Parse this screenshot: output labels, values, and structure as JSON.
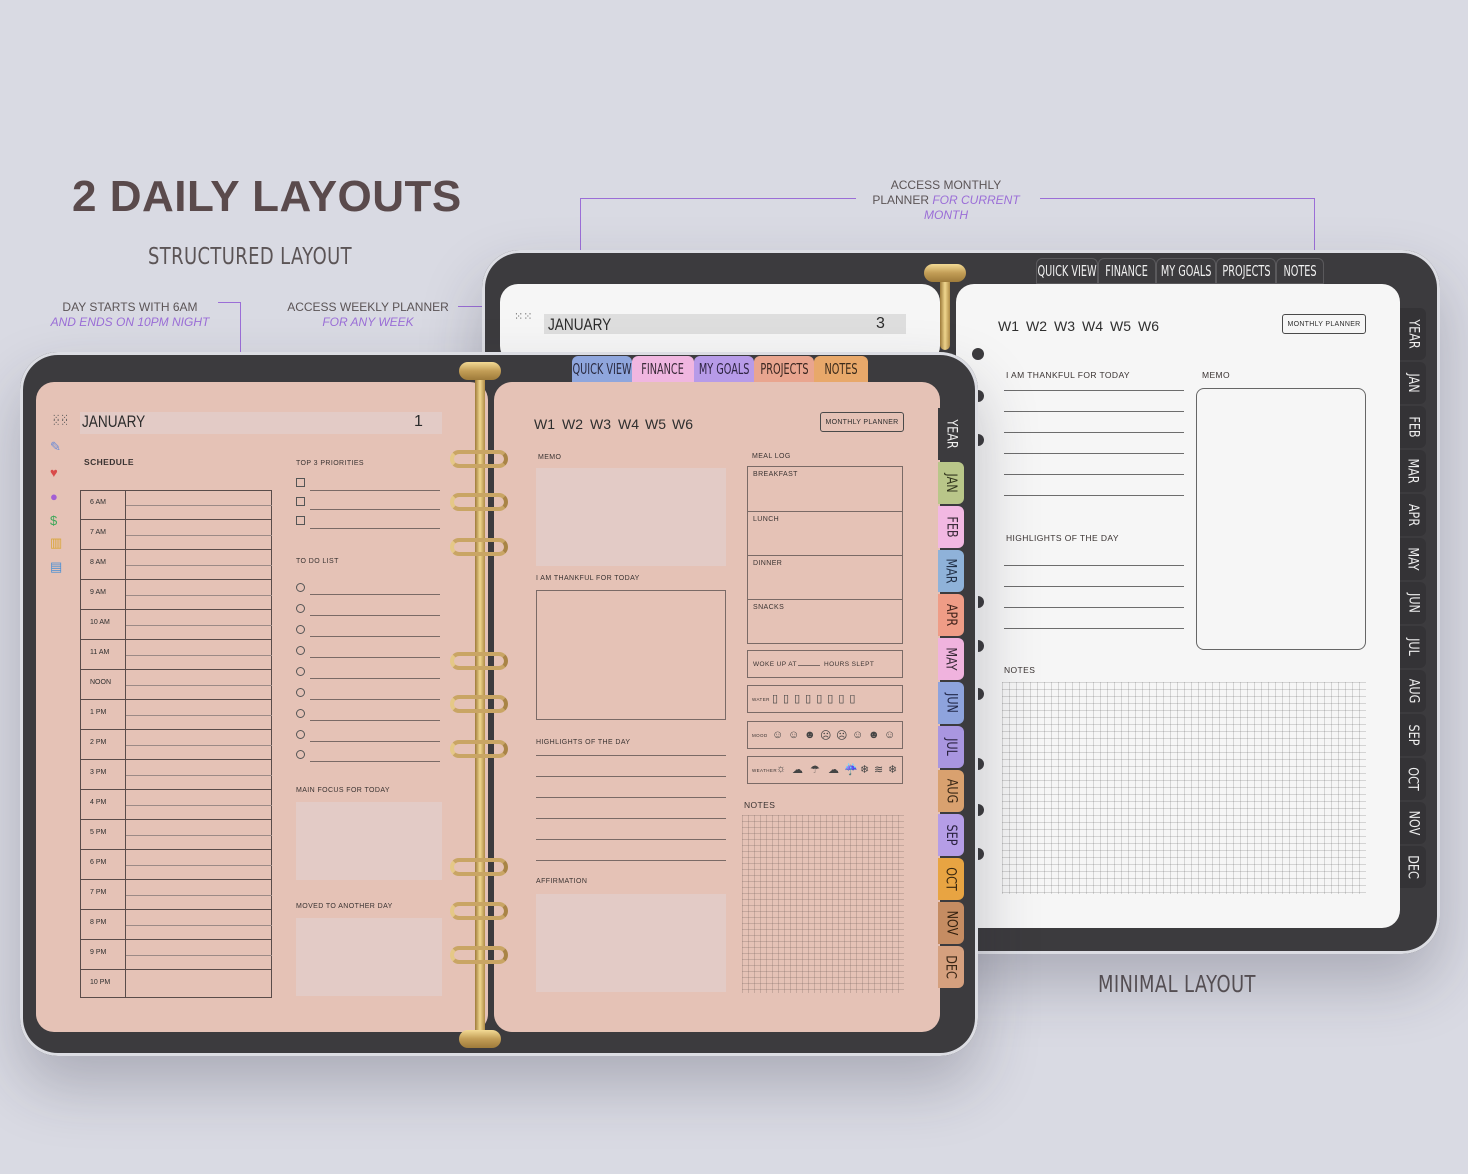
{
  "heading": "2 DAILY LAYOUTS",
  "structured_label": "STRUCTURED LAYOUT",
  "minimal_label": "MINIMAL LAYOUT",
  "annotations": {
    "day_starts": {
      "line1": "DAY STARTS WITH 6AM",
      "line2": "AND ENDS ON 10PM NIGHT"
    },
    "weekly": {
      "line1": "ACCESS WEEKLY PLANNER",
      "line2": "FOR ANY WEEK"
    },
    "monthly": {
      "line1": "ACCESS MONTHLY",
      "line2a": "PLANNER",
      "line2b": "FOR CURRENT",
      "line3": "MONTH"
    }
  },
  "top_tabs": [
    "QUICK VIEW",
    "FINANCE",
    "MY GOALS",
    "PROJECTS",
    "NOTES"
  ],
  "side_tabs": [
    "YEAR",
    "JAN",
    "FEB",
    "MAR",
    "APR",
    "MAY",
    "JUN",
    "JUL",
    "AUG",
    "SEP",
    "OCT",
    "NOV",
    "DEC"
  ],
  "weeks": [
    "W1",
    "W2",
    "W3",
    "W4",
    "W5",
    "W6"
  ],
  "monthly_button": "MONTHLY PLANNER",
  "structured": {
    "month": "JANUARY",
    "day": "1",
    "schedule_label": "SCHEDULE",
    "hours": [
      "6 AM",
      "7 AM",
      "8 AM",
      "9 AM",
      "10 AM",
      "11 AM",
      "NOON",
      "1 PM",
      "2 PM",
      "3 PM",
      "4 PM",
      "5 PM",
      "6 PM",
      "7 PM",
      "8 PM",
      "9 PM",
      "10 PM"
    ],
    "priorities_label": "TOP 3 PRIORITIES",
    "todo_label": "TO DO LIST",
    "main_focus_label": "MAIN FOCUS FOR TODAY",
    "moved_label": "MOVED TO ANOTHER DAY",
    "memo_label": "MEMO",
    "thankful_label": "I AM THANKFUL FOR TODAY",
    "highlights_label": "HIGHLIGHTS OF THE DAY",
    "affirmation_label": "AFFIRMATION",
    "meal_log_label": "MEAL LOG",
    "meals": [
      "BREAKFAST",
      "LUNCH",
      "DINNER",
      "SNACKS"
    ],
    "woke_label": "WOKE UP AT",
    "slept_label": "HOURS SLEPT",
    "water_label": "WATER",
    "mood_label": "MOOD",
    "weather_label": "WEATHER",
    "mood_icons": [
      "☺",
      "☺",
      "☻",
      "☹",
      "☹",
      "☺",
      "☻",
      "☺",
      "☹"
    ],
    "weather_icons": [
      "☼",
      "☁",
      "☂",
      "☁",
      "☔",
      "❄",
      "≋",
      "❄"
    ],
    "notes_label": "NOTES"
  },
  "minimal": {
    "month": "JANUARY",
    "day": "3",
    "thankful_label": "I AM THANKFUL FOR TODAY",
    "memo_label": "MEMO",
    "highlights_label": "HIGHLIGHTS OF THE DAY",
    "notes_label": "NOTES"
  },
  "colors": {
    "accent": "#9b6ed7",
    "pink_page": "#e5c2b6",
    "tab_quick_view": "#8fa6dd",
    "tab_finance": "#f0b6e0",
    "tab_my_goals": "#b79be8",
    "tab_projects": "#e9a58f",
    "tab_notes": "#e8a86a"
  }
}
